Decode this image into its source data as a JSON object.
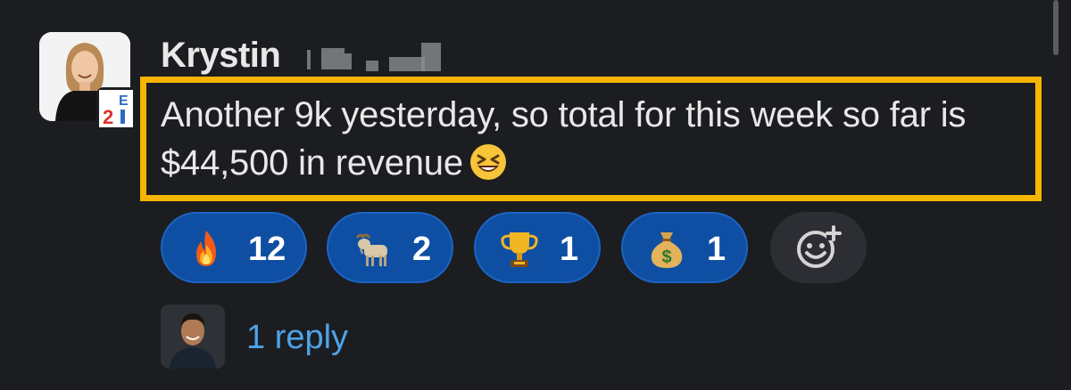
{
  "message": {
    "sender_name": "Krystin",
    "text": "Another 9k yesterday, so total for this week so far is $44,500 in revenue",
    "inline_emoji": "laughing-face",
    "org_badge_text": "E2I"
  },
  "reactions": [
    {
      "emoji": "fire",
      "count": "12"
    },
    {
      "emoji": "goat",
      "count": "2"
    },
    {
      "emoji": "trophy",
      "count": "1"
    },
    {
      "emoji": "money-bag",
      "count": "1"
    }
  ],
  "add_reaction_icon": "add-emoji-icon",
  "thread": {
    "reply_text": "1 reply"
  },
  "colors": {
    "background": "#1b1d21",
    "highlight": "#f6b500",
    "reaction_bg": "#0f4fa3",
    "link": "#4ea3e8"
  }
}
